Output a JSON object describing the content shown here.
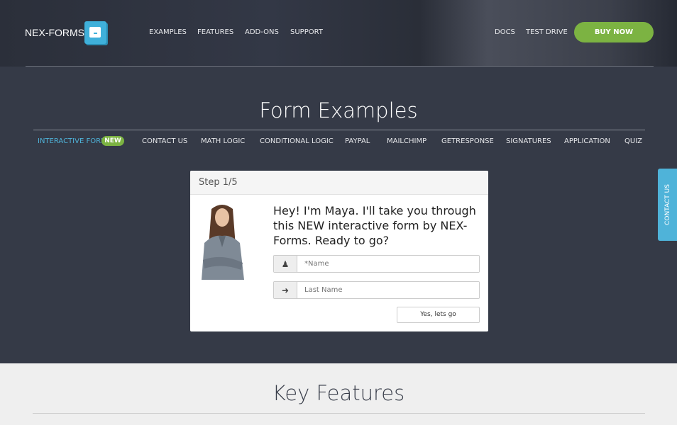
{
  "header": {
    "logo_text": "NEX-FORMS",
    "nav": [
      "EXAMPLES",
      "FEATURES",
      "ADD-ONS",
      "SUPPORT"
    ],
    "right_nav": [
      "DOCS",
      "TEST DRIVE"
    ],
    "buy_label": "BUY NOW"
  },
  "hero": {
    "title": "Form Examples",
    "tabs": [
      "INTERACTIVE FORM",
      "CONTACT US",
      "MATH LOGIC",
      "CONDITIONAL LOGIC",
      "PAYPAL",
      "MAILCHIMP",
      "GETRESPONSE",
      "SIGNATURES",
      "APPLICATION",
      "QUIZ"
    ],
    "active_tab": "INTERACTIVE FORM",
    "new_badge": "NEW"
  },
  "form": {
    "step": "Step 1/5",
    "message": "Hey! I'm Maya. I'll take you through this NEW interactive form by NEX-Forms. Ready to go?",
    "name_placeholder": "*Name",
    "last_name_placeholder": "Last Name",
    "submit_label": "Yes, lets go",
    "icons": [
      "user-icon",
      "arrow-right-icon"
    ]
  },
  "side_tab": "CONTACT US",
  "features": {
    "title": "Key Features"
  },
  "colors": {
    "accent": "#4fb3d9",
    "green": "#7cb342",
    "bg": "#353a47"
  }
}
